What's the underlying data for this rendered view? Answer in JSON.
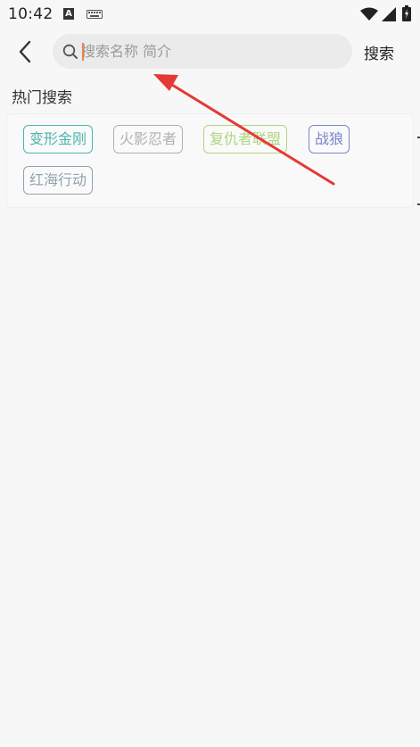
{
  "status_bar": {
    "time": "10:42",
    "app_badge": "A",
    "icons": [
      "keyboard-icon",
      "wifi-icon",
      "signal-icon",
      "battery-icon"
    ]
  },
  "header": {
    "back_icon": "chevron-left-icon",
    "search": {
      "placeholder": "搜索名称 简介",
      "value": ""
    },
    "search_button_label": "搜索"
  },
  "hot_search": {
    "title": "热门搜索",
    "tags": [
      {
        "label": "变形金刚",
        "color": "#4db6ac"
      },
      {
        "label": "火影忍者",
        "color": "#b0b0b0"
      },
      {
        "label": "复仇者联盟",
        "color": "#aed581"
      },
      {
        "label": "战狼",
        "color": "#7986cb"
      },
      {
        "label": "红海行动",
        "color": "#90a4ae"
      }
    ]
  },
  "colors": {
    "background": "#f7f7f7",
    "search_box": "#ebebeb",
    "annotation_arrow": "#e53935",
    "caret": "#e8874b"
  }
}
